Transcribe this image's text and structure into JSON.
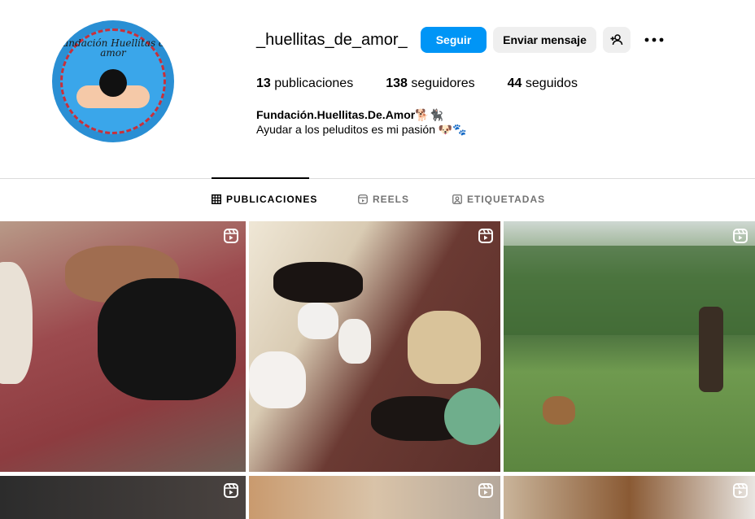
{
  "profile": {
    "username": "_huellitas_de_amor_",
    "avatar_text": "Fundación Huellitas de amor",
    "follow_label": "Seguir",
    "message_label": "Enviar mensaje",
    "add_person_icon": "person-add-icon",
    "more_icon": "more-horizontal-icon",
    "stats": {
      "posts_count": "13",
      "posts_label": "publicaciones",
      "followers_count": "138",
      "followers_label": "seguidores",
      "following_count": "44",
      "following_label": "seguidos"
    },
    "full_name": "Fundación.Huellitas.De.Amor🐕🐈‍⬛",
    "bio": "Ayudar a los peluditos es mi pasión 🐶🐾"
  },
  "tabs": [
    {
      "label": "PUBLICACIONES",
      "icon": "grid-icon",
      "active": true
    },
    {
      "label": "REELS",
      "icon": "reels-icon",
      "active": false
    },
    {
      "label": "ETIQUETADAS",
      "icon": "tagged-icon",
      "active": false
    }
  ],
  "colors": {
    "accent": "#0095f6",
    "secondary_button": "#efefef",
    "divider": "#dbdbdb",
    "muted_text": "#737373"
  },
  "posts": [
    {
      "type": "reel",
      "icon": "reel-icon"
    },
    {
      "type": "reel",
      "icon": "reel-icon"
    },
    {
      "type": "reel",
      "icon": "reel-icon"
    },
    {
      "type": "reel",
      "icon": "reel-icon"
    },
    {
      "type": "reel",
      "icon": "reel-icon"
    },
    {
      "type": "reel",
      "icon": "reel-icon"
    }
  ]
}
